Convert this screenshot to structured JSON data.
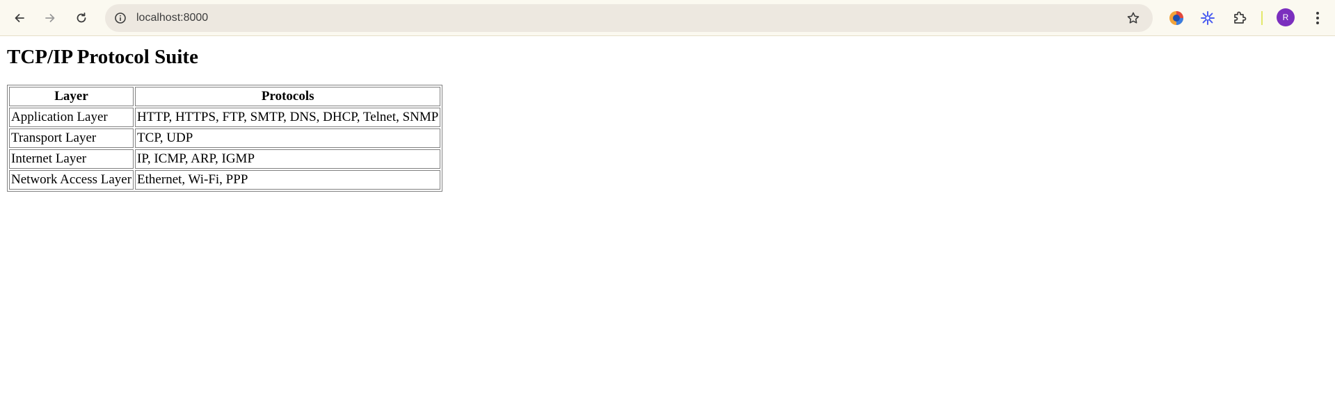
{
  "browser": {
    "url": "localhost:8000",
    "avatar_letter": "R",
    "icons": {
      "back": "arrow-left-icon",
      "forward": "arrow-right-icon",
      "reload": "reload-icon",
      "info": "info-icon",
      "bookmark": "star-icon",
      "extension_a": "colorful-extension-icon",
      "extension_b": "snowflake-extension-icon",
      "extensions": "puzzle-icon",
      "menu": "kebab-menu-icon"
    },
    "avatar_color": "#7b2fbe"
  },
  "page": {
    "title": "TCP/IP Protocol Suite",
    "table": {
      "headers": [
        "Layer",
        "Protocols"
      ],
      "rows": [
        [
          "Application Layer",
          "HTTP, HTTPS, FTP, SMTP, DNS, DHCP, Telnet, SNMP"
        ],
        [
          "Transport Layer",
          "TCP, UDP"
        ],
        [
          "Internet Layer",
          "IP, ICMP, ARP, IGMP"
        ],
        [
          "Network Access Layer",
          "Ethernet, Wi-Fi, PPP"
        ]
      ]
    }
  }
}
